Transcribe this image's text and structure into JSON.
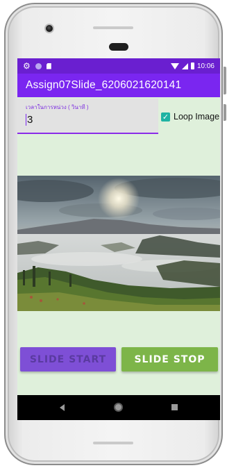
{
  "status_bar": {
    "time": "10:06",
    "icons": [
      "gear-icon",
      "dot-icon",
      "sd-card-icon",
      "wifi-icon",
      "signal-icon",
      "battery-icon"
    ]
  },
  "app_bar": {
    "title": "Assign07Slide_6206021620141"
  },
  "interval_input": {
    "label": "เวลาในการหน่วง ( วินาที )",
    "value": "3"
  },
  "loop_checkbox": {
    "label": "Loop Image",
    "checked": true
  },
  "buttons": {
    "start_label": "SLIDE START",
    "stop_label": "SLIDE STOP"
  },
  "colors": {
    "status_bar": "#6a1fd0",
    "app_bar": "#7a26f0",
    "screen_bg": "#dff0db",
    "start_button": "#7e4fd6",
    "stop_button": "#7db549",
    "checkbox": "#1fb3a3"
  },
  "nav_bar": {
    "icons": [
      "back-icon",
      "home-icon",
      "recent-apps-icon"
    ]
  }
}
